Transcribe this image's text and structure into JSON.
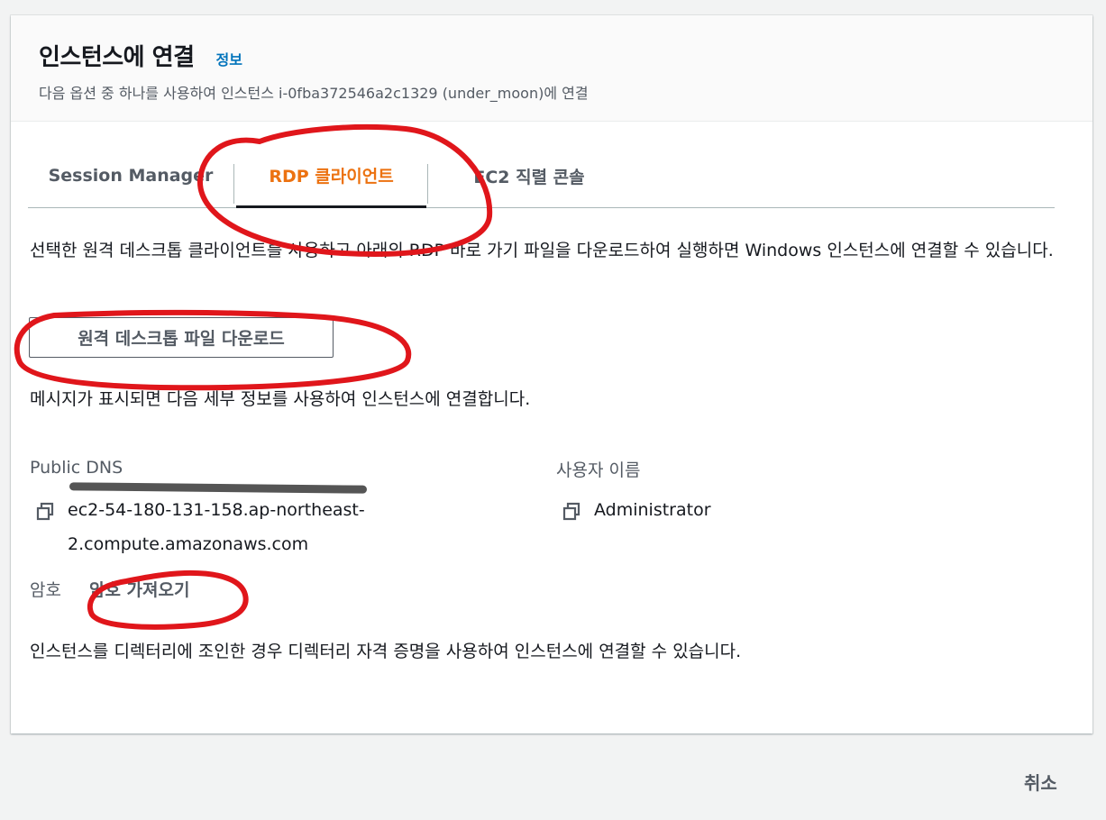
{
  "header": {
    "title": "인스턴스에 연결",
    "info_link": "정보",
    "subtitle": "다음 옵션 중 하나를 사용하여 인스턴스 i-0fba372546a2c1329 (under_moon)에 연결"
  },
  "tabs": [
    {
      "label": "Session Manager",
      "active": false
    },
    {
      "label": "RDP 클라이언트",
      "active": true
    },
    {
      "label": "EC2 직렬 콘솔",
      "active": false
    }
  ],
  "rdp": {
    "description": "선택한 원격 데스크톱 클라이언트를 사용하고 아래의 RDP 바로 가기 파일을 다운로드하여 실행하면 Windows 인스턴스에 연결할 수 있습니다.",
    "download_button": "원격 데스크톱 파일 다운로드",
    "prompt_text": "메시지가 표시되면 다음 세부 정보를 사용하여 인스턴스에 연결합니다.",
    "public_dns_label": "Public DNS",
    "public_dns_value": "ec2-54-180-131-158.ap-northeast-2.compute.amazonaws.com",
    "username_label": "사용자 이름",
    "username_value": "Administrator",
    "password_label": "암호",
    "get_password_link": "암호 가져오기",
    "directory_note": "인스턴스를 디렉터리에 조인한 경우 디렉터리 자격 증명을 사용하여 인스턴스에 연결할 수 있습니다."
  },
  "footer": {
    "cancel_button": "취소"
  },
  "colors": {
    "accent": "#ec7211",
    "link": "#0073bb",
    "annotation": "#e0161b"
  },
  "icons": {
    "copy": "copy-icon"
  }
}
